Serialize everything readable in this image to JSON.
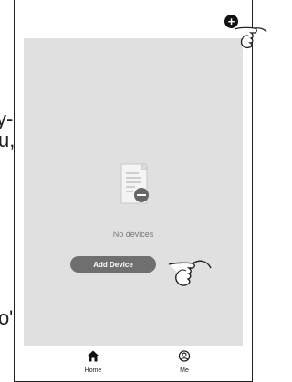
{
  "side_text": {
    "line1": "y-",
    "line2": "u,",
    "line3": "o\":"
  },
  "header": {
    "add_icon": "plus-circle-icon",
    "add_symbol": "+"
  },
  "main": {
    "empty_icon": "document-remove-icon",
    "empty_text": "No devices",
    "add_device_label": "Add Device"
  },
  "tabs": [
    {
      "label": "Home",
      "icon": "home-icon"
    },
    {
      "label": "Me",
      "icon": "user-circle-icon"
    }
  ],
  "colors": {
    "content_bg": "#e0e0e0",
    "button_bg": "#6f6f6f",
    "icon_dark": "#111111"
  }
}
